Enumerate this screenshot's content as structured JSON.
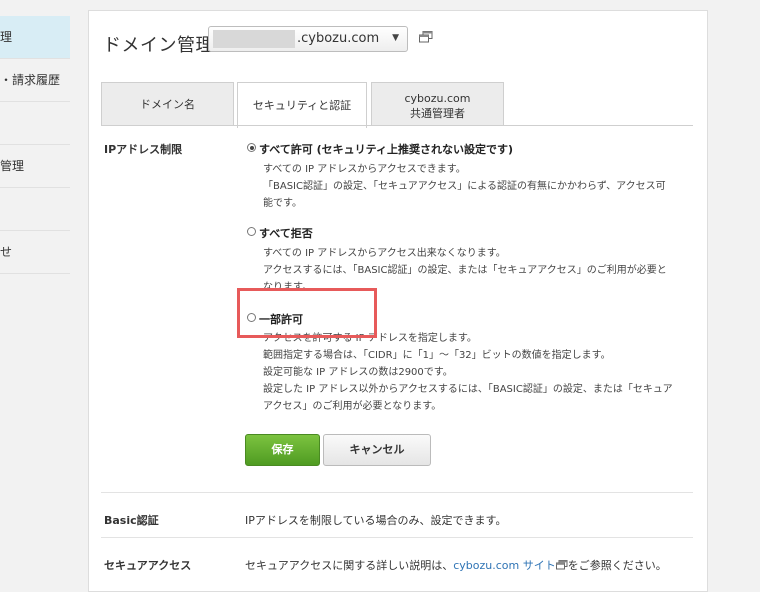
{
  "sidebar": {
    "items": [
      {
        "label": "理"
      },
      {
        "label": "・請求履歴"
      },
      {
        "label": ""
      },
      {
        "label": "管理"
      },
      {
        "label": ""
      },
      {
        "label": "せ"
      }
    ]
  },
  "header": {
    "title": "ドメイン管理",
    "domain_suffix": ".cybozu.com"
  },
  "tabs": [
    {
      "label": "ドメイン名"
    },
    {
      "label": "セキュリティと認証"
    },
    {
      "label_line1": "cybozu.com",
      "label_line2": "共通管理者"
    }
  ],
  "ip": {
    "label": "IPアドレス制限",
    "options": [
      {
        "title": "すべて許可 (セキュリティ上推奨されない設定です)",
        "checked": true,
        "desc": [
          "すべての IP アドレスからアクセスできます。",
          "「BASIC認証」の設定、「セキュアアクセス」による認証の有無にかかわらず、アクセス可",
          "能です。"
        ]
      },
      {
        "title": "すべて拒否",
        "checked": false,
        "desc": [
          "すべての IP アドレスからアクセス出来なくなります。",
          "アクセスするには、「BASIC認証」の設定、または「セキュアアクセス」のご利用が必要と",
          "なります。"
        ]
      },
      {
        "title": "一部許可",
        "checked": false,
        "desc": [
          "アクセスを許可する IP アドレスを指定します。",
          "範囲指定する場合は、「CIDR」に「1」～「32」ビットの数値を指定します。",
          "設定可能な IP アドレスの数は2900です。",
          "設定した IP アドレス以外からアクセスするには、「BASIC認証」の設定、または「セキュア",
          "アクセス」のご利用が必要となります。"
        ]
      }
    ]
  },
  "buttons": {
    "save": "保存",
    "cancel": "キャンセル"
  },
  "basic": {
    "label": "Basic認証",
    "text": "IPアドレスを制限している場合のみ、設定できます。"
  },
  "secure": {
    "label": "セキュアアクセス",
    "text_before": "セキュアアクセスに関する詳しい説明は、",
    "link": "cybozu.com サイト",
    "text_after": "をご参照ください。"
  },
  "colors": {
    "accent_green": "#5aa82a",
    "link": "#2f74b5",
    "highlight": "#e75a5a",
    "active_nav": "#d8edf5"
  }
}
